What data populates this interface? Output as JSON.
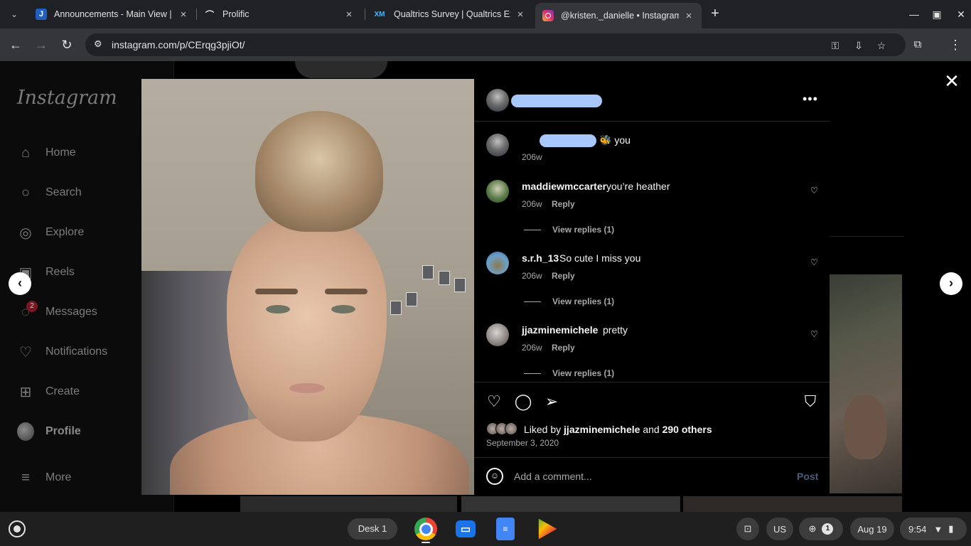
{
  "browser": {
    "tabs": [
      {
        "title": "Announcements - Main View | U",
        "favicon": "canvas-icon",
        "close": "×"
      },
      {
        "title": "Prolific",
        "favicon": "prolific-icon",
        "close": "×"
      },
      {
        "title": "Qualtrics Survey | Qualtrics Exp",
        "favicon": "qualtrics-icon",
        "close": "×"
      },
      {
        "title": "@kristen._danielle • Instagram",
        "favicon": "instagram-icon",
        "close": "×",
        "active": true
      }
    ],
    "url": "instagram.com/p/CErqg3pjiOt/",
    "accent": "#a8c7fa"
  },
  "sidebar": {
    "logo": "Instagram",
    "items": [
      {
        "label": "Home",
        "icon": "home-icon"
      },
      {
        "label": "Search",
        "icon": "search-icon"
      },
      {
        "label": "Explore",
        "icon": "compass-icon"
      },
      {
        "label": "Reels",
        "icon": "reels-icon"
      },
      {
        "label": "Messages",
        "icon": "messenger-icon",
        "badge": "2"
      },
      {
        "label": "Notifications",
        "icon": "heart-icon"
      },
      {
        "label": "Create",
        "icon": "plus-square-icon"
      },
      {
        "label": "Profile",
        "icon": "avatar"
      },
      {
        "label": "More",
        "icon": "menu-icon"
      }
    ]
  },
  "post": {
    "comments": [
      {
        "text": "🐝 you",
        "time": "206w"
      },
      {
        "user": "maddiewmccarter",
        "text": "you’re heather",
        "time": "206w",
        "reply": "Reply",
        "view_replies": "View replies (1)"
      },
      {
        "user": "s.r.h_13",
        "text": "So cute I miss you",
        "time": "206w",
        "reply": "Reply",
        "view_replies": "View replies (1)"
      },
      {
        "user": "jjazminemichele",
        "text": "pretty",
        "time": "206w",
        "reply": "Reply",
        "view_replies": "View replies (1)"
      }
    ],
    "liked_prefix": "Liked by",
    "liked_user": "jjazminemichele",
    "liked_and": "and",
    "liked_others": "290 others",
    "date": "September 3, 2020",
    "comment_placeholder": "Add a comment...",
    "post_label": "Post"
  },
  "shelf": {
    "desk": "Desk 1",
    "ime": "US",
    "notif_count": "1",
    "date": "Aug 19",
    "time": "9:54"
  }
}
